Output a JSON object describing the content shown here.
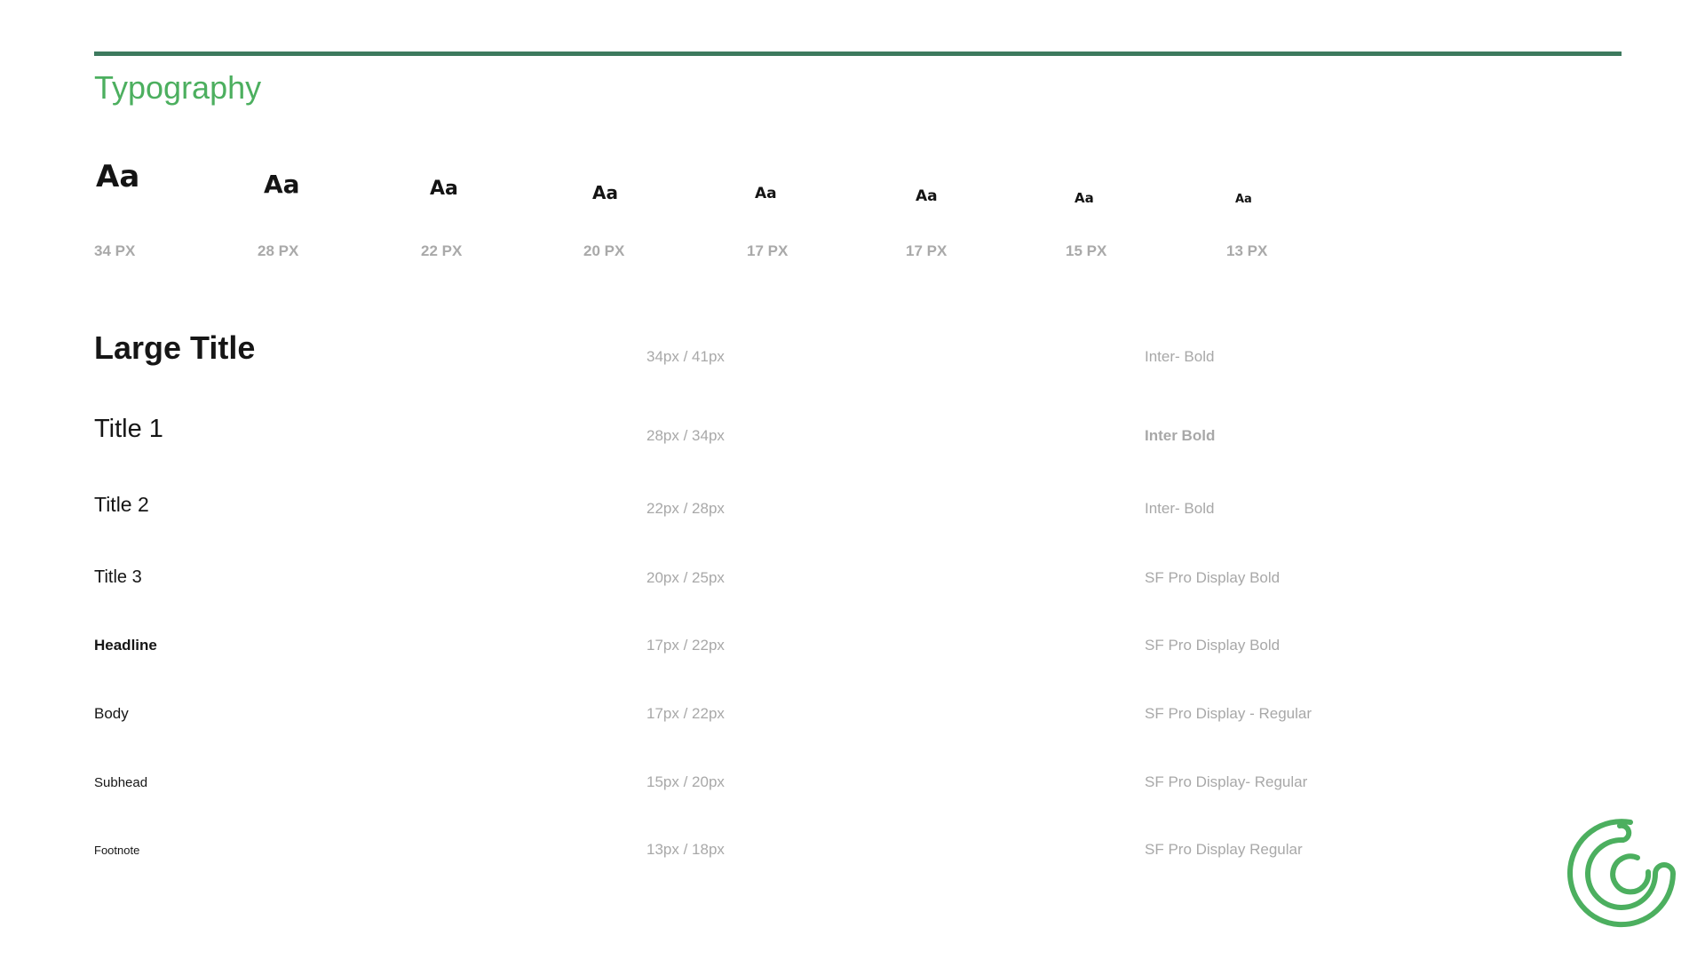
{
  "page": {
    "title": "Typography",
    "accent_color": "#4caf5f",
    "rule_color": "#3d7a5e"
  },
  "scale": [
    {
      "sample": "Aa",
      "label": "34 PX"
    },
    {
      "sample": "Aa",
      "label": "28 PX"
    },
    {
      "sample": "Aa",
      "label": "22 PX"
    },
    {
      "sample": "Aa",
      "label": "20 PX"
    },
    {
      "sample": "Aa",
      "label": "17 PX"
    },
    {
      "sample": "Aa",
      "label": "17 PX"
    },
    {
      "sample": "Aa",
      "label": "15 PX"
    },
    {
      "sample": "Aa",
      "label": "13 PX"
    }
  ],
  "styles": [
    {
      "name": "Large Title",
      "metrics": "34px / 41px",
      "font": "Inter- Bold"
    },
    {
      "name": "Title 1",
      "metrics": "28px / 34px",
      "font": "Inter Bold"
    },
    {
      "name": "Title 2",
      "metrics": "22px / 28px",
      "font": "Inter- Bold"
    },
    {
      "name": "Title 3",
      "metrics": "20px / 25px",
      "font": "SF Pro Display Bold"
    },
    {
      "name": "Headline",
      "metrics": "17px / 22px",
      "font": "SF Pro Display Bold"
    },
    {
      "name": "Body",
      "metrics": "17px / 22px",
      "font": "SF Pro Display - Regular"
    },
    {
      "name": "Subhead",
      "metrics": "15px / 20px",
      "font": "SF Pro Display- Regular"
    },
    {
      "name": "Footnote",
      "metrics": "13px / 18px",
      "font": "SF Pro Display Regular"
    }
  ],
  "logo": {
    "icon": "spiral-logo-icon",
    "color": "#4caf5f"
  }
}
